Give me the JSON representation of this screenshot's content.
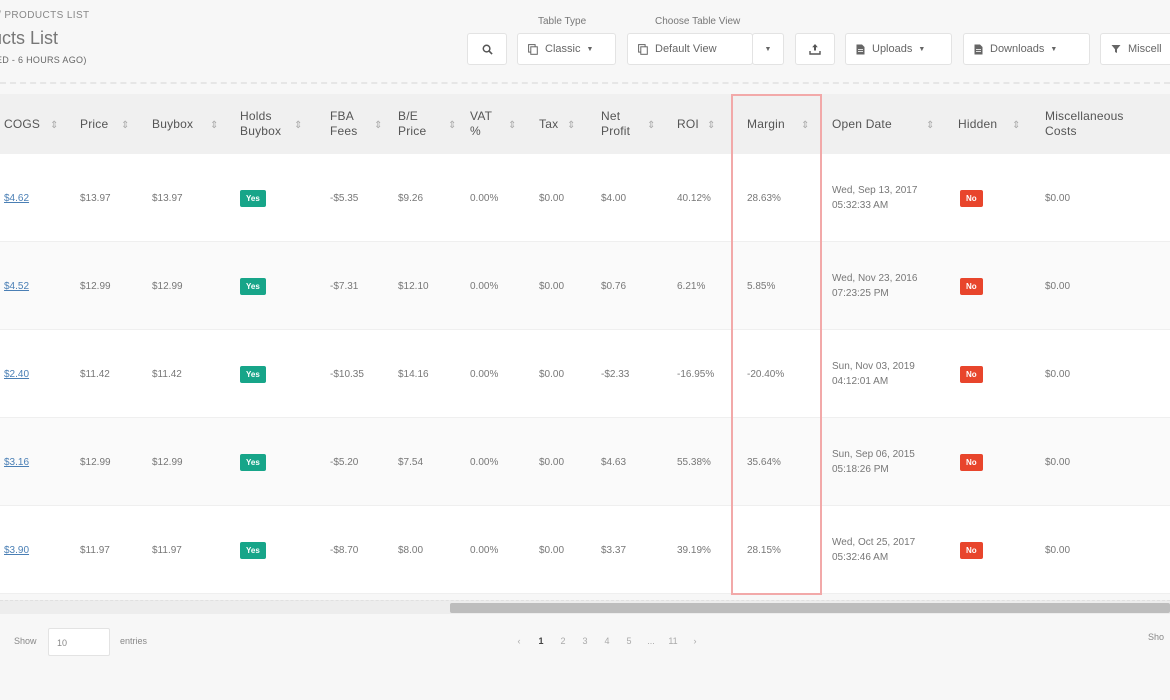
{
  "header": {
    "breadcrumb": "/ PRODUCTS LIST",
    "title": "ucts List",
    "last_updated": "ED - 6 HOURS AGO)",
    "table_type_caption": "Table Type",
    "table_view_caption": "Choose Table View"
  },
  "toolbar": {
    "table_type_value": "Classic",
    "table_view_value": "Default View",
    "uploads_label": "Uploads",
    "downloads_label": "Downloads",
    "misc_label": "Miscell"
  },
  "columns": [
    {
      "label": "COGS"
    },
    {
      "label": "Price"
    },
    {
      "label": "Buybox"
    },
    {
      "label": "Holds Buybox"
    },
    {
      "label": "FBA Fees"
    },
    {
      "label": "B/E Price"
    },
    {
      "label": "VAT %"
    },
    {
      "label": "Tax"
    },
    {
      "label": "Net Profit"
    },
    {
      "label": "ROI"
    },
    {
      "label": "Margin"
    },
    {
      "label": "Open Date"
    },
    {
      "label": "Hidden"
    },
    {
      "label": "Miscellaneous Costs"
    }
  ],
  "rows": [
    {
      "cogs": "$4.62",
      "price": "$13.97",
      "buybox": "$13.97",
      "holds_buybox": "Yes",
      "fba_fees": "-$5.35",
      "be_price": "$9.26",
      "vat": "0.00%",
      "tax": "$0.00",
      "net_profit": "$4.00",
      "roi": "40.12%",
      "margin": "28.63%",
      "open_date_1": "Wed, Sep 13, 2017",
      "open_date_2": "05:32:33 AM",
      "hidden": "No",
      "misc_costs": "$0.00"
    },
    {
      "cogs": "$4.52",
      "price": "$12.99",
      "buybox": "$12.99",
      "holds_buybox": "Yes",
      "fba_fees": "-$7.31",
      "be_price": "$12.10",
      "vat": "0.00%",
      "tax": "$0.00",
      "net_profit": "$0.76",
      "roi": "6.21%",
      "margin": "5.85%",
      "open_date_1": "Wed, Nov 23, 2016",
      "open_date_2": "07:23:25 PM",
      "hidden": "No",
      "misc_costs": "$0.00"
    },
    {
      "cogs": "$2.40",
      "price": "$11.42",
      "buybox": "$11.42",
      "holds_buybox": "Yes",
      "fba_fees": "-$10.35",
      "be_price": "$14.16",
      "vat": "0.00%",
      "tax": "$0.00",
      "net_profit": "-$2.33",
      "roi": "-16.95%",
      "margin": "-20.40%",
      "open_date_1": "Sun, Nov 03, 2019",
      "open_date_2": "04:12:01 AM",
      "hidden": "No",
      "misc_costs": "$0.00"
    },
    {
      "cogs": "$3.16",
      "price": "$12.99",
      "buybox": "$12.99",
      "holds_buybox": "Yes",
      "fba_fees": "-$5.20",
      "be_price": "$7.54",
      "vat": "0.00%",
      "tax": "$0.00",
      "net_profit": "$4.63",
      "roi": "55.38%",
      "margin": "35.64%",
      "open_date_1": "Sun, Sep 06, 2015",
      "open_date_2": "05:18:26 PM",
      "hidden": "No",
      "misc_costs": "$0.00"
    },
    {
      "cogs": "$3.90",
      "price": "$11.97",
      "buybox": "$11.97",
      "holds_buybox": "Yes",
      "fba_fees": "-$8.70",
      "be_price": "$8.00",
      "vat": "0.00%",
      "tax": "$0.00",
      "net_profit": "$3.37",
      "roi": "39.19%",
      "margin": "28.15%",
      "open_date_1": "Wed, Oct 25, 2017",
      "open_date_2": "05:32:46 AM",
      "hidden": "No",
      "misc_costs": "$0.00"
    }
  ],
  "footer": {
    "show_label": "Show",
    "entries_value": "10",
    "entries_label": "entries",
    "pager": [
      "‹",
      "1",
      "2",
      "3",
      "4",
      "5",
      "...",
      "11",
      "›"
    ],
    "showing_label": "Sho"
  },
  "colors": {
    "yes_badge": "#17a589",
    "no_badge": "#e8452c",
    "highlight": "#f2a9a9",
    "link": "#4a7fb5"
  }
}
